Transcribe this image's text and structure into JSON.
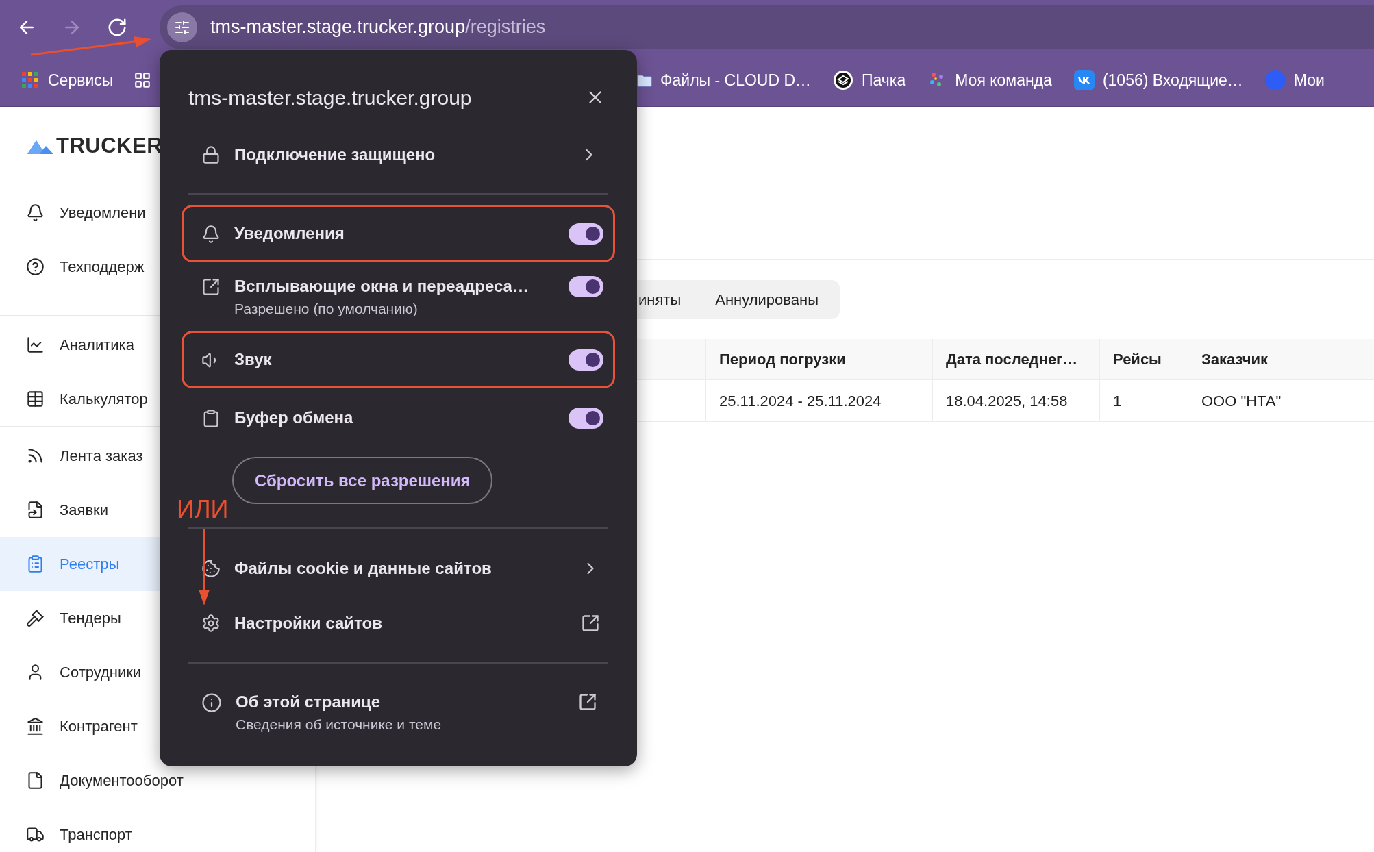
{
  "browser": {
    "nav": [
      {
        "kind": "back",
        "disabled": false
      },
      {
        "kind": "forward",
        "disabled": true
      },
      {
        "kind": "reload",
        "disabled": false
      }
    ],
    "address_bar": {
      "host": "tms-master.stage.trucker.group",
      "path": "/registries"
    },
    "bookmarks": [
      "Сервисы",
      "Файлы - CLOUD D…",
      "Пачка",
      "Моя команда",
      "(1056) Входящие…",
      "Мои"
    ]
  },
  "sidebar": {
    "logo": "TRUCKER",
    "groups": [
      [
        {
          "label": "Уведомлени",
          "selected": false
        },
        {
          "label": "Техподдерж",
          "selected": false
        }
      ],
      [
        {
          "label": "Аналитика",
          "selected": false
        },
        {
          "label": "Калькулятор",
          "selected": false
        }
      ],
      [
        {
          "label": "Лента заказ",
          "selected": false
        },
        {
          "label": "Заявки",
          "selected": false
        },
        {
          "label": "Реестры",
          "selected": true
        },
        {
          "label": "Тендеры",
          "selected": false
        },
        {
          "label": "Сотрудники",
          "selected": false
        },
        {
          "label": "Контрагент",
          "selected": false
        },
        {
          "label": "Документооборот",
          "selected": false
        },
        {
          "label": "Транспорт",
          "selected": false
        }
      ]
    ]
  },
  "main": {
    "tabs": [
      {
        "label": "иняты",
        "selected": false
      },
      {
        "label": "Аннулированы",
        "selected": false
      }
    ],
    "table": {
      "columns": [
        "Период погрузки",
        "Дата последнег…",
        "Рейсы",
        "Заказчик"
      ],
      "rows": [
        [
          "25.11.2024 - 25.11.2024",
          "18.04.2025, 14:58",
          "1",
          "ООО \"НТА\""
        ]
      ]
    }
  },
  "site_popup": {
    "title": "tms-master.stage.trucker.group",
    "connection": "Подключение защищено",
    "permissions": [
      {
        "kind": "notifications",
        "label": "Уведомления",
        "on": true,
        "highlighted": true
      },
      {
        "kind": "popups",
        "label": "Всплывающие окна и переадреса…",
        "subtitle": "Разрешено (по умолчанию)",
        "on": true,
        "highlighted": false
      },
      {
        "kind": "sound",
        "label": "Звук",
        "on": true,
        "highlighted": true
      },
      {
        "kind": "clipboard",
        "label": "Буфер обмена",
        "on": true,
        "highlighted": false
      }
    ],
    "reset_button": "Сбросить все разрешения",
    "links": [
      {
        "kind": "chevron",
        "label": "Файлы cookie и данные сайтов"
      },
      {
        "kind": "external",
        "label": "Настройки сайтов"
      }
    ],
    "about": {
      "label": "Об этой странице",
      "subtitle": "Сведения об источнике и теме"
    }
  },
  "annotation": {
    "text": "ИЛИ"
  }
}
